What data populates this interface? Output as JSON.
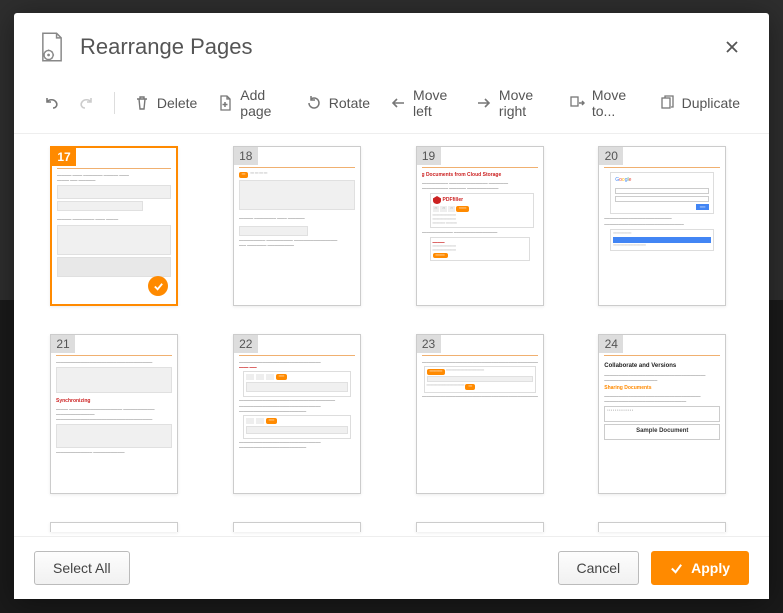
{
  "title": "Rearrange Pages",
  "toolbar": {
    "undo": "Undo",
    "redo": "Redo",
    "delete": "Delete",
    "add_page": "Add page",
    "rotate": "Rotate",
    "move_left": "Move left",
    "move_right": "Move right",
    "move_to": "Move to...",
    "duplicate": "Duplicate"
  },
  "pages": [
    {
      "num": "17",
      "selected": true,
      "kind": "p17"
    },
    {
      "num": "18",
      "selected": false,
      "kind": "p18"
    },
    {
      "num": "19",
      "selected": false,
      "kind": "p19"
    },
    {
      "num": "20",
      "selected": false,
      "kind": "p20"
    },
    {
      "num": "21",
      "selected": false,
      "kind": "p21"
    },
    {
      "num": "22",
      "selected": false,
      "kind": "p22"
    },
    {
      "num": "23",
      "selected": false,
      "kind": "p23"
    },
    {
      "num": "24",
      "selected": false,
      "kind": "p24"
    }
  ],
  "thumb_text": {
    "p19_heading": "g Documents from Cloud Storage",
    "p19_brand": "PDFfiller",
    "p21_heading": "Synchronizing",
    "p24_heading": "Collaborate and Versions",
    "p24_sub": "Sharing Documents",
    "p24_sample": "Sample Document"
  },
  "footer": {
    "select_all": "Select All",
    "cancel": "Cancel",
    "apply": "Apply"
  }
}
